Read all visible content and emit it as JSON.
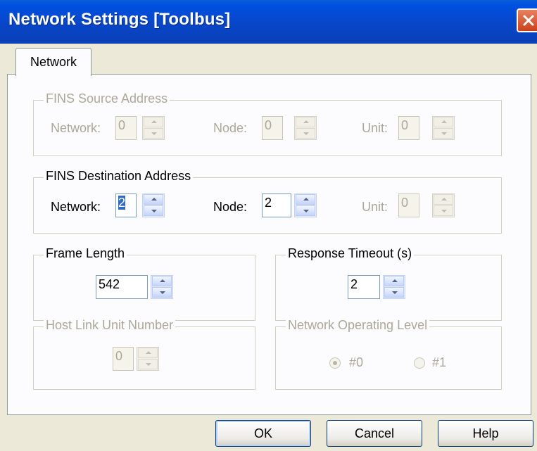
{
  "window": {
    "title": "Network Settings [Toolbus]"
  },
  "tabs": [
    {
      "label": "Network"
    }
  ],
  "fins_source": {
    "legend": "FINS Source Address",
    "network": {
      "label": "Network:",
      "value": "0"
    },
    "node": {
      "label": "Node:",
      "value": "0"
    },
    "unit": {
      "label": "Unit:",
      "value": "0"
    }
  },
  "fins_destination": {
    "legend": "FINS Destination Address",
    "network": {
      "label": "Network:",
      "value": "2"
    },
    "node": {
      "label": "Node:",
      "value": "2"
    },
    "unit": {
      "label": "Unit:",
      "value": "0"
    }
  },
  "frame_length": {
    "legend": "Frame Length",
    "value": "542"
  },
  "response_timeout": {
    "legend": "Response Timeout (s)",
    "value": "2"
  },
  "host_link": {
    "legend": "Host Link Unit Number",
    "value": "0"
  },
  "operating_level": {
    "legend": "Network Operating Level",
    "options": [
      "#0",
      "#1"
    ],
    "selected": "#0"
  },
  "buttons": {
    "ok": "OK",
    "cancel": "Cancel",
    "help": "Help"
  },
  "colors": {
    "title_bar": "#0846c8",
    "close_button": "#c9421d",
    "dialog_bg": "#ece9d8"
  },
  "icons": {
    "close": "close-icon"
  }
}
